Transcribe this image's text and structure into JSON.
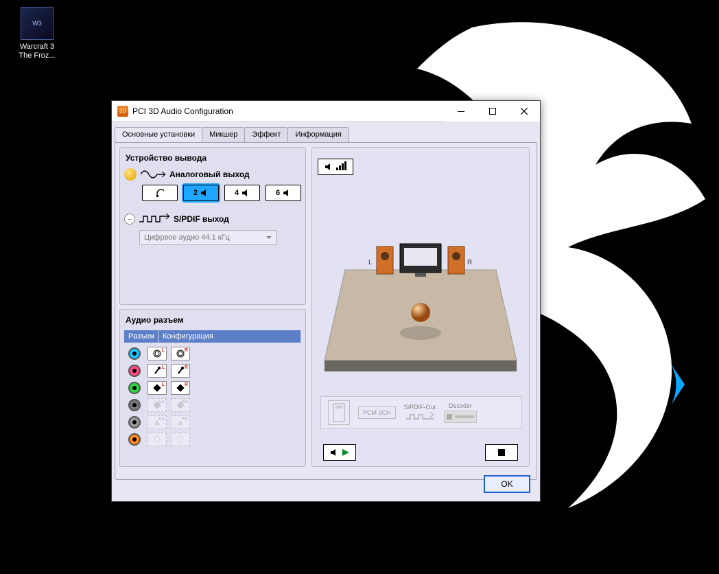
{
  "desktop": {
    "icon1": {
      "label": "Warcraft 3\nThe Froz..."
    }
  },
  "window": {
    "title": "PCI 3D Audio Configuration",
    "tabs": [
      {
        "label": "Основные установки"
      },
      {
        "label": "Микшер"
      },
      {
        "label": "Эффект"
      },
      {
        "label": "Информация"
      }
    ],
    "output": {
      "group_title": "Устройство вывода",
      "analog_label": "Аналоговый выход",
      "btn2": "2",
      "btn4": "4",
      "btn6": "6",
      "spdif_label": "S/PDIF выход",
      "spdif_rate": "Цифрвое аудио 44.1 кГц"
    },
    "jacks": {
      "group_title": "Аудио разъем",
      "col_jack": "Разъем",
      "col_conf": "Конфигурация"
    },
    "preview": {
      "left_label": "L",
      "right_label": "R",
      "spdif_out_label": "S/PDIF-Out",
      "decoder_label": "Decoder",
      "pcm_label": "PCM 2CH"
    },
    "ok": "OK"
  }
}
